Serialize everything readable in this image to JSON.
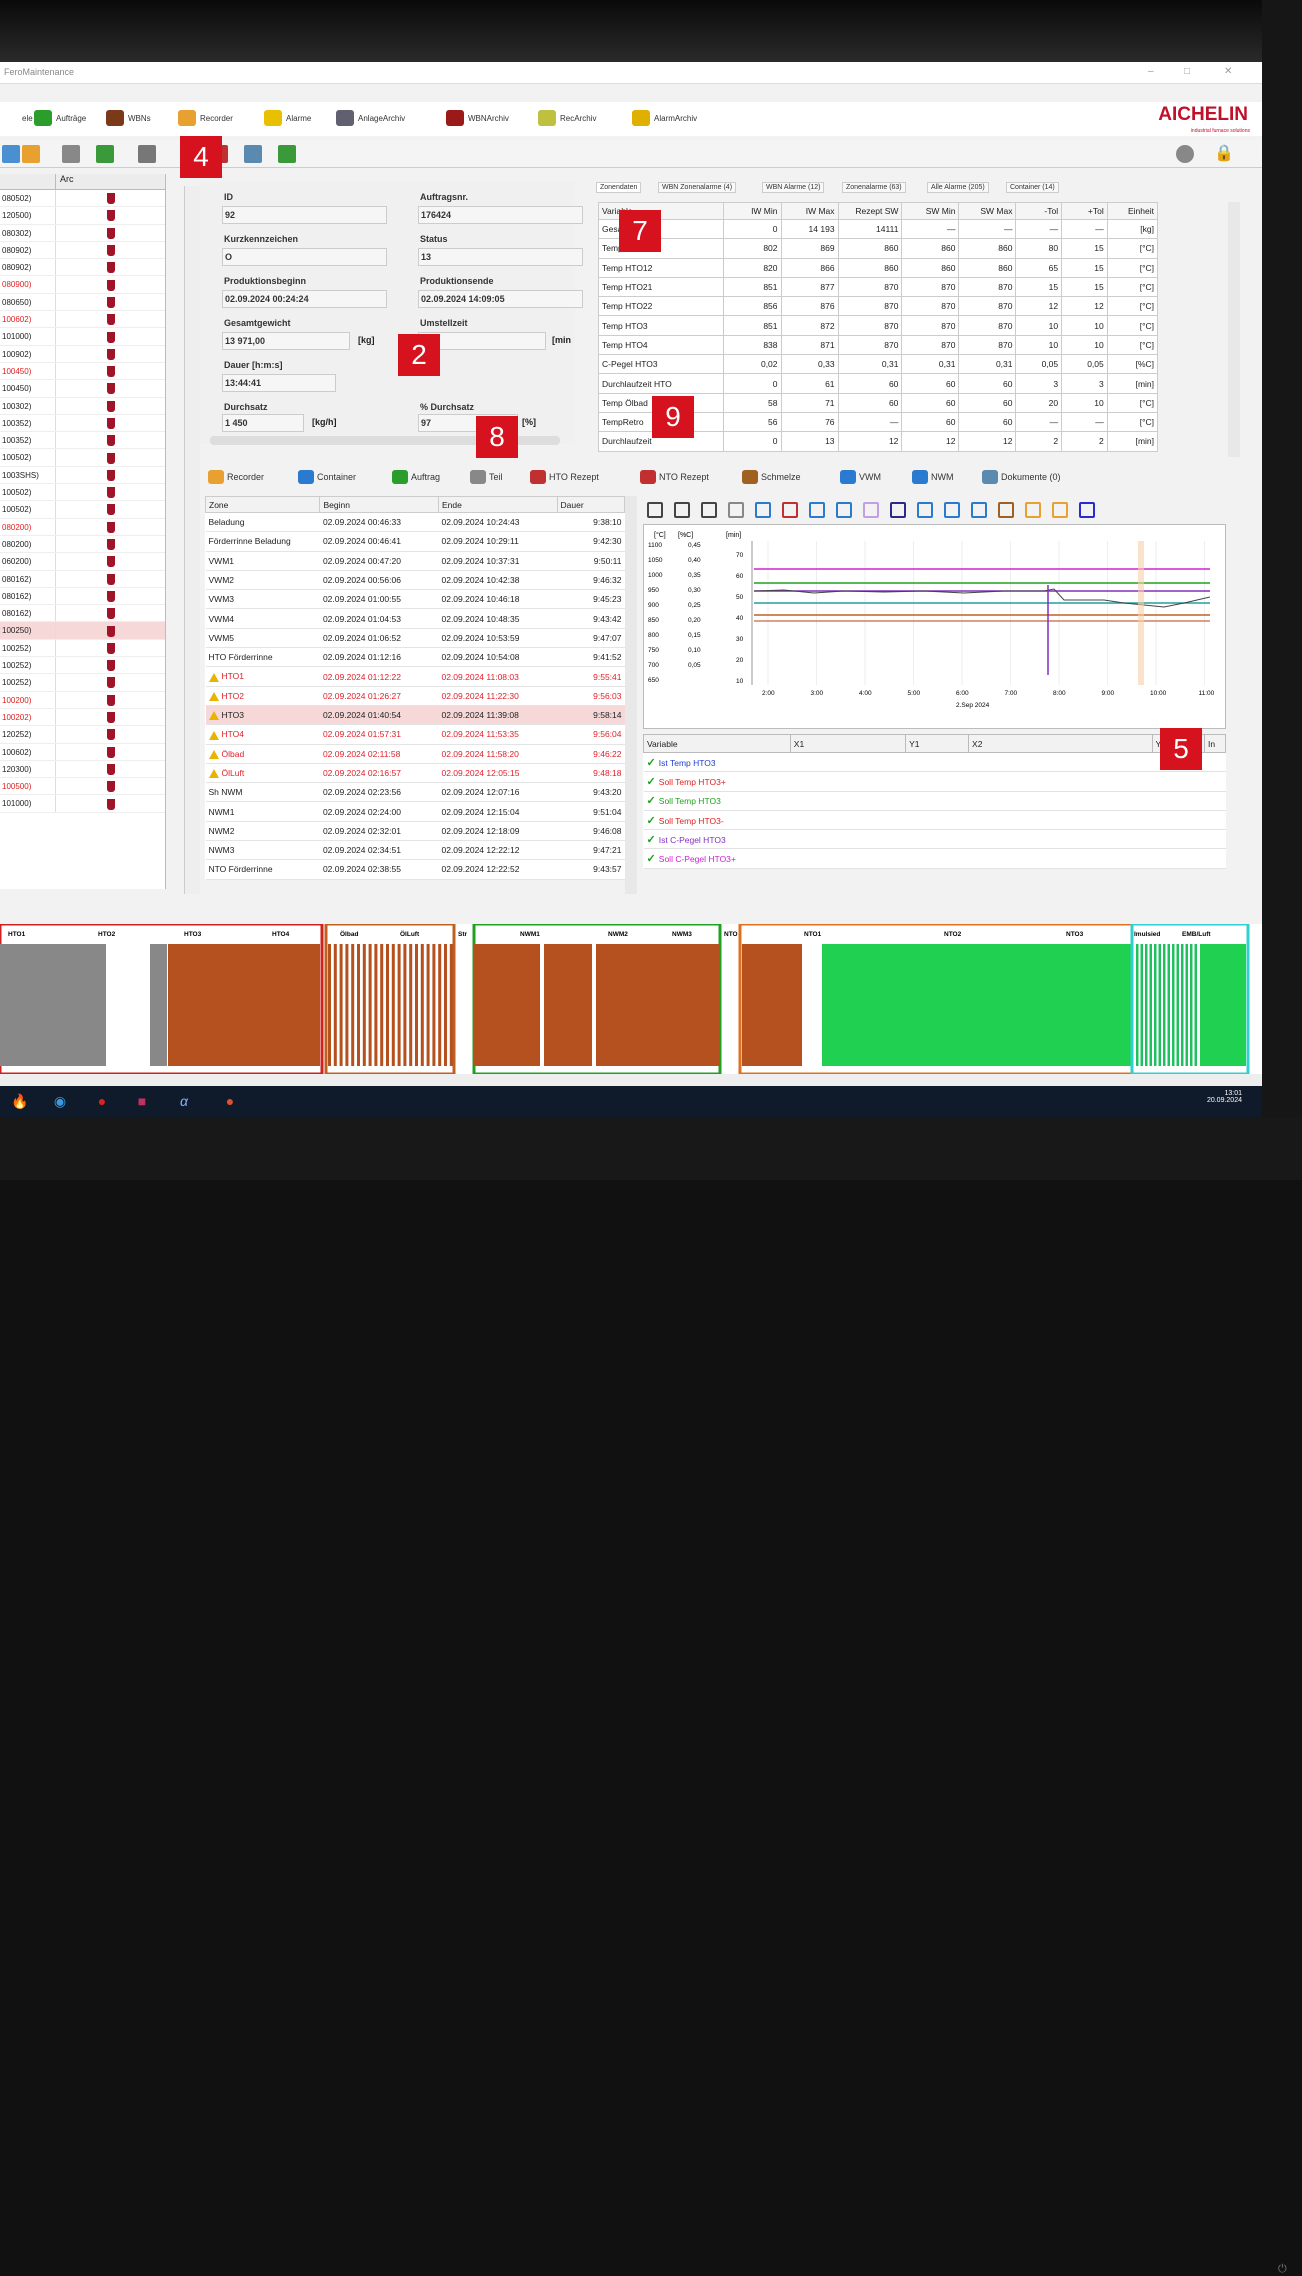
{
  "window": {
    "title": "FeroMaintenance",
    "min": "–",
    "max": "□",
    "close": "✕"
  },
  "menu": [
    {
      "label": "ele",
      "color": "#ffffff"
    },
    {
      "label": "Aufträge",
      "color": "#2a9d2a"
    },
    {
      "label": "WBNs",
      "color": "#7a3a1a"
    },
    {
      "label": "Recorder",
      "color": "#e8a030"
    },
    {
      "label": "Alarme",
      "color": "#e8c000"
    },
    {
      "label": "AnlageArchiv",
      "color": "#606070"
    },
    {
      "label": "WBNArchiv",
      "color": "#9a1a1a"
    },
    {
      "label": "RecArchiv",
      "color": "#c0c040"
    },
    {
      "label": "AlarmArchiv",
      "color": "#e0b000"
    }
  ],
  "logo": {
    "name": "AICHELIN",
    "sub": "industrial furnace solutions"
  },
  "left": {
    "header": [
      "",
      "Arc"
    ],
    "rows": [
      {
        "id": "080502)",
        "red": false
      },
      {
        "id": "120500)",
        "red": false
      },
      {
        "id": "080302)",
        "red": false
      },
      {
        "id": "080902)",
        "red": false
      },
      {
        "id": "080902)",
        "red": false
      },
      {
        "id": "080900)",
        "red": true
      },
      {
        "id": "080650)",
        "red": false
      },
      {
        "id": "100602)",
        "red": true
      },
      {
        "id": "101000)",
        "red": false
      },
      {
        "id": "100902)",
        "red": false
      },
      {
        "id": "100450)",
        "red": true
      },
      {
        "id": "100450)",
        "red": false
      },
      {
        "id": "100302)",
        "red": false
      },
      {
        "id": "100352)",
        "red": false
      },
      {
        "id": "100352)",
        "red": false
      },
      {
        "id": "100502)",
        "red": false
      },
      {
        "id": "1003SHS)",
        "red": false
      },
      {
        "id": "100502)",
        "red": false
      },
      {
        "id": "100502)",
        "red": false
      },
      {
        "id": "080200)",
        "red": true
      },
      {
        "id": "080200)",
        "red": false
      },
      {
        "id": "060200)",
        "red": false
      },
      {
        "id": "080162)",
        "red": false
      },
      {
        "id": "080162)",
        "red": false
      },
      {
        "id": "080162)",
        "red": false
      },
      {
        "id": "100250)",
        "red": false
      },
      {
        "id": "100252)",
        "red": false
      },
      {
        "id": "100252)",
        "red": false
      },
      {
        "id": "100252)",
        "red": false
      },
      {
        "id": "100200)",
        "red": true
      },
      {
        "id": "100202)",
        "red": true
      },
      {
        "id": "120252)",
        "red": false
      },
      {
        "id": "100602)",
        "red": false
      },
      {
        "id": "120300)",
        "red": false
      },
      {
        "id": "100500)",
        "red": true
      },
      {
        "id": "101000)",
        "red": false
      }
    ]
  },
  "form": {
    "id_label": "ID",
    "id": "92",
    "auftrag_label": "Auftragsnr.",
    "auftrag": "176424",
    "kurz_label": "Kurzkennzeichen",
    "kurz": "O",
    "status_label": "Status",
    "status": "13",
    "pbeginn_label": "Produktionsbeginn",
    "pbeginn": "02.09.2024 00:24:24",
    "pende_label": "Produktionsende",
    "pende": "02.09.2024 14:09:05",
    "gewicht_label": "Gesamtgewicht",
    "gewicht": "13 971,00",
    "gewicht_unit": "[kg]",
    "umstell_label": "Umstellzeit",
    "umstell_unit": "[min",
    "dauer_label": "Dauer [h:m:s]",
    "dauer": "13:44:41",
    "durchsatz_label": "Durchsatz",
    "durchsatz": "1 450",
    "durchsatz_unit": "[kg/h]",
    "pdurch_label": "% Durchsatz",
    "pdurch": "97",
    "pdurch_unit": "[%]"
  },
  "zonetabs": [
    "Zonendaten",
    "WBN Zonenalarme (4)",
    "WBN Alarme (12)",
    "Zonenalarme (63)",
    "Alle Alarme (205)",
    "Container (14)"
  ],
  "ztable": {
    "headers": [
      "Variable",
      "IW Min",
      "IW Max",
      "Rezept SW",
      "SW Min",
      "SW Max",
      "-Tol",
      "+Tol",
      "Einheit"
    ],
    "rows": [
      [
        "Gesamtgewicht",
        "0",
        "14 193",
        "14111",
        "—",
        "—",
        "—",
        "—",
        "[kg]"
      ],
      [
        "Temp HTO11",
        "802",
        "869",
        "860",
        "860",
        "860",
        "80",
        "15",
        "[°C]"
      ],
      [
        "Temp HTO12",
        "820",
        "866",
        "860",
        "860",
        "860",
        "65",
        "15",
        "[°C]"
      ],
      [
        "Temp HTO21",
        "851",
        "877",
        "870",
        "870",
        "870",
        "15",
        "15",
        "[°C]"
      ],
      [
        "Temp HTO22",
        "856",
        "876",
        "870",
        "870",
        "870",
        "12",
        "12",
        "[°C]"
      ],
      [
        "Temp HTO3",
        "851",
        "872",
        "870",
        "870",
        "870",
        "10",
        "10",
        "[°C]"
      ],
      [
        "Temp HTO4",
        "838",
        "871",
        "870",
        "870",
        "870",
        "10",
        "10",
        "[°C]"
      ],
      [
        "C-Pegel HTO3",
        "0,02",
        "0,33",
        "0,31",
        "0,31",
        "0,31",
        "0,05",
        "0,05",
        "[%C]"
      ],
      [
        "Durchlaufzeit HTO",
        "0",
        "61",
        "60",
        "60",
        "60",
        "3",
        "3",
        "[min]"
      ],
      [
        "Temp Ölbad",
        "58",
        "71",
        "60",
        "60",
        "60",
        "20",
        "10",
        "[°C]"
      ],
      [
        "TempRetro",
        "56",
        "76",
        "—",
        "60",
        "60",
        "—",
        "—",
        "[°C]"
      ],
      [
        "Durchlaufzeit",
        "0",
        "13",
        "12",
        "12",
        "12",
        "2",
        "2",
        "[min]"
      ]
    ]
  },
  "subtabs": [
    "Recorder",
    "Container",
    "Auftrag",
    "Teil",
    "HTO Rezept",
    "NTO Rezept",
    "Schmelze",
    "VWM",
    "NWM",
    "Dokumente (0)"
  ],
  "zonegrid": {
    "headers": [
      "Zone",
      "Beginn",
      "Ende",
      "Dauer"
    ],
    "rows": [
      {
        "z": "Beladung",
        "b": "02.09.2024 00:46:33",
        "e": "02.09.2024 10:24:43",
        "d": "9:38:10",
        "s": ""
      },
      {
        "z": "Förderrinne Beladung",
        "b": "02.09.2024 00:46:41",
        "e": "02.09.2024 10:29:11",
        "d": "9:42:30",
        "s": ""
      },
      {
        "z": "VWM1",
        "b": "02.09.2024 00:47:20",
        "e": "02.09.2024 10:37:31",
        "d": "9:50:11",
        "s": ""
      },
      {
        "z": "VWM2",
        "b": "02.09.2024 00:56:06",
        "e": "02.09.2024 10:42:38",
        "d": "9:46:32",
        "s": ""
      },
      {
        "z": "VWM3",
        "b": "02.09.2024 01:00:55",
        "e": "02.09.2024 10:46:18",
        "d": "9:45:23",
        "s": ""
      },
      {
        "z": "VWM4",
        "b": "02.09.2024 01:04:53",
        "e": "02.09.2024 10:48:35",
        "d": "9:43:42",
        "s": ""
      },
      {
        "z": "VWM5",
        "b": "02.09.2024 01:06:52",
        "e": "02.09.2024 10:53:59",
        "d": "9:47:07",
        "s": ""
      },
      {
        "z": "HTO Förderrinne",
        "b": "02.09.2024 01:12:16",
        "e": "02.09.2024 10:54:08",
        "d": "9:41:52",
        "s": ""
      },
      {
        "z": "HTO1",
        "b": "02.09.2024 01:12:22",
        "e": "02.09.2024 11:08:03",
        "d": "9:55:41",
        "s": "red"
      },
      {
        "z": "HTO2",
        "b": "02.09.2024 01:26:27",
        "e": "02.09.2024 11:22:30",
        "d": "9:56:03",
        "s": "red"
      },
      {
        "z": "HTO3",
        "b": "02.09.2024 01:40:54",
        "e": "02.09.2024 11:39:08",
        "d": "9:58:14",
        "s": "sel"
      },
      {
        "z": "HTO4",
        "b": "02.09.2024 01:57:31",
        "e": "02.09.2024 11:53:35",
        "d": "9:56:04",
        "s": "red"
      },
      {
        "z": "Ölbad",
        "b": "02.09.2024 02:11:58",
        "e": "02.09.2024 11:58:20",
        "d": "9:46:22",
        "s": "red"
      },
      {
        "z": "ÖlLuft",
        "b": "02.09.2024 02:16:57",
        "e": "02.09.2024 12:05:15",
        "d": "9:48:18",
        "s": "red"
      },
      {
        "z": "Sh NWM",
        "b": "02.09.2024 02:23:56",
        "e": "02.09.2024 12:07:16",
        "d": "9:43:20",
        "s": ""
      },
      {
        "z": "NWM1",
        "b": "02.09.2024 02:24:00",
        "e": "02.09.2024 12:15:04",
        "d": "9:51:04",
        "s": ""
      },
      {
        "z": "NWM2",
        "b": "02.09.2024 02:32:01",
        "e": "02.09.2024 12:18:09",
        "d": "9:46:08",
        "s": ""
      },
      {
        "z": "NWM3",
        "b": "02.09.2024 02:34:51",
        "e": "02.09.2024 12:22:12",
        "d": "9:47:21",
        "s": ""
      },
      {
        "z": "NTO Förderrinne",
        "b": "02.09.2024 02:38:55",
        "e": "02.09.2024 12:22:52",
        "d": "9:43:57",
        "s": ""
      }
    ]
  },
  "chart": {
    "y1_unit": "[°C]",
    "y2_unit": "[%C]",
    "y3_unit": "[min]",
    "y1_ticks": [
      "1100",
      "1050",
      "1000",
      "950",
      "900",
      "850",
      "800",
      "750",
      "700",
      "650"
    ],
    "y2_ticks": [
      "0,45",
      "0,40",
      "0,35",
      "0,30",
      "0,25",
      "0,20",
      "0,15",
      "0,10",
      "0,05"
    ],
    "y3_ticks": [
      "70",
      "60",
      "50",
      "40",
      "30",
      "20",
      "10"
    ],
    "x_ticks": [
      "2:00",
      "3:00",
      "4:00",
      "5:00",
      "6:00",
      "7:00",
      "8:00",
      "9:00",
      "10:00",
      "11:00"
    ],
    "date": "2.Sep 2024",
    "colors": [
      "#d020d0",
      "#20a020",
      "#8030c0",
      "#20a0a0",
      "#c06020",
      "#d08060"
    ]
  },
  "vartable": {
    "headers": [
      "Variable",
      "X1",
      "Y1",
      "X2",
      "Y2",
      "In"
    ],
    "rows": [
      {
        "label": "Ist Temp HTO3",
        "color": "#2040d0"
      },
      {
        "label": "Soll Temp HTO3+",
        "color": "#e02020"
      },
      {
        "label": "Soll Temp HTO3",
        "color": "#20a020"
      },
      {
        "label": "Soll Temp HTO3-",
        "color": "#e02020"
      },
      {
        "label": "Ist C-Pegel HTO3",
        "color": "#8030c0"
      },
      {
        "label": "Soll C-Pegel HTO3+",
        "color": "#d020d0"
      }
    ]
  },
  "timeline": {
    "labels": [
      "HTO1",
      "HTO2",
      "HTO3",
      "HTO4",
      "Ölbad",
      "ÖlLuft",
      "Str",
      "NWM1",
      "NWM2",
      "NWM3",
      "NTO",
      "NTO1",
      "NTO2",
      "NTO3",
      "Imulsied",
      "EMB/Luft"
    ]
  },
  "badges": [
    "4",
    "7",
    "2",
    "8",
    "9",
    "5"
  ],
  "clock": {
    "time": "13:01",
    "date": "20.09.2024"
  }
}
